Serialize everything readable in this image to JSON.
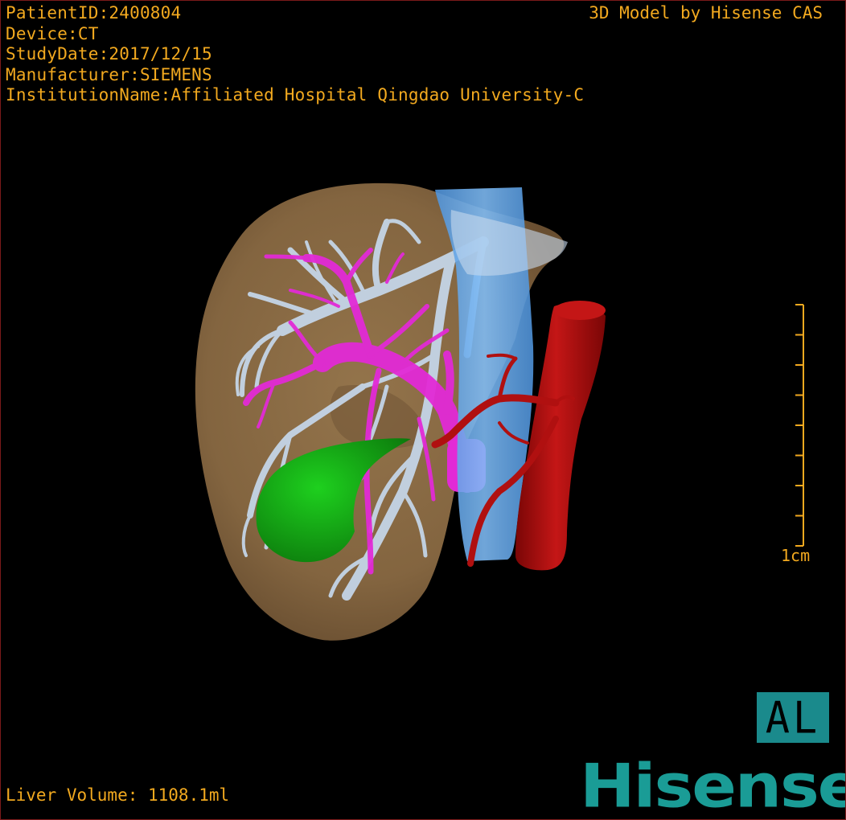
{
  "header": {
    "patient_id": "PatientID:2400804",
    "device": "Device:CT",
    "study_date": "StudyDate:2017/12/15",
    "manufacturer": "Manufacturer:SIEMENS",
    "institution": "InstitutionName:Affiliated Hospital Qingdao University-C"
  },
  "model_credit": "3D Model by Hisense CAS",
  "liver_volume": "Liver Volume: 1108.1ml",
  "scale": {
    "label": "1cm",
    "tick_count": 9
  },
  "orientation": "AL",
  "brand": "Hisense",
  "colors": {
    "overlay_text": "#f2a91f",
    "liver": "#8a6a43",
    "portal_vein": "#e22ad6",
    "hepatic_vein": "#c6d8ec",
    "vena_cava": "#6aaef0",
    "aorta": "#b01010",
    "gallbladder": "#14a814",
    "brand": "#1a9c96"
  }
}
